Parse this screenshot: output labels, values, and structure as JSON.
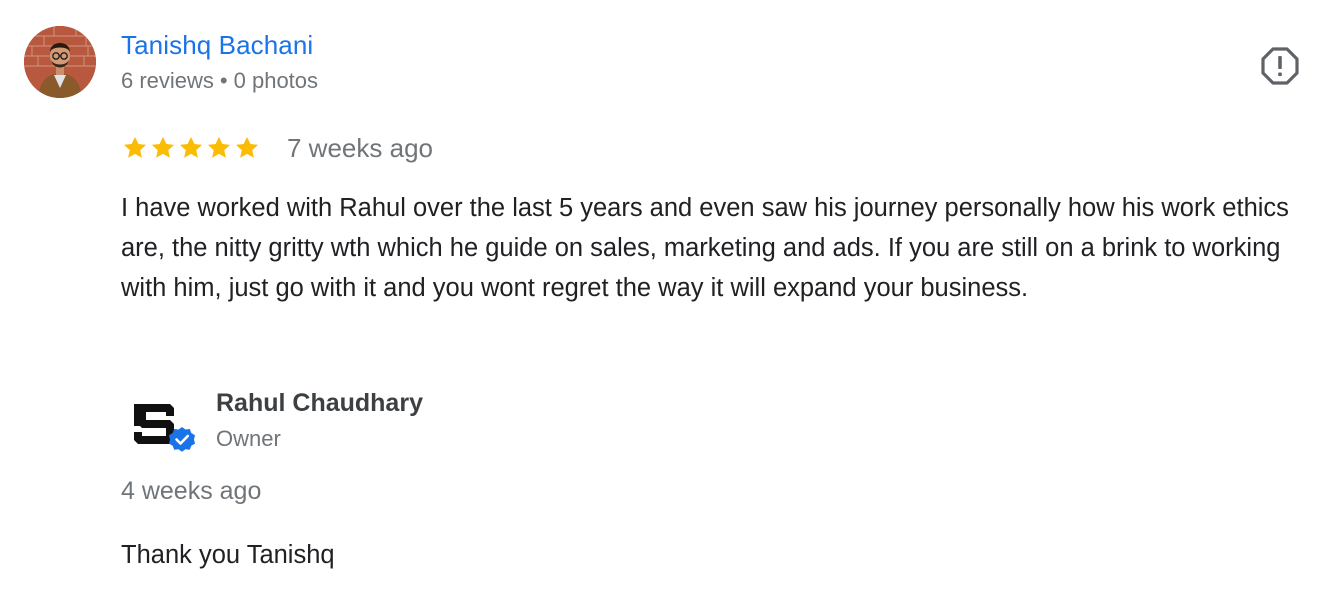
{
  "review": {
    "reviewer": {
      "name": "Tanishq Bachani",
      "reviews_count": "6 reviews",
      "separator": "•",
      "photos_count": "0 photos",
      "avatar_icon": "user-photo"
    },
    "rating": {
      "stars_filled": 5,
      "stars_total": 5,
      "star_color": "#fbbc04"
    },
    "date": "7 weeks ago",
    "text": "I have worked with Rahul over the last 5 years and even saw his journey personally how his work ethics are, the nitty gritty wth which he guide on sales, marketing and ads. If you are still on a brink to working with him, just go with it and you wont regret the way it will expand your business.",
    "report_icon": "report-flag-icon"
  },
  "owner_reply": {
    "name": "Rahul Chaudhary",
    "role": "Owner",
    "logo_icon": "business-logo",
    "verified_icon": "verified-badge-icon",
    "verified_color": "#1a73e8",
    "date": "4 weeks ago",
    "text": "Thank you Tanishq"
  },
  "colors": {
    "link": "#1a73e8",
    "secondary_text": "#70757a",
    "primary_text": "#202124"
  }
}
